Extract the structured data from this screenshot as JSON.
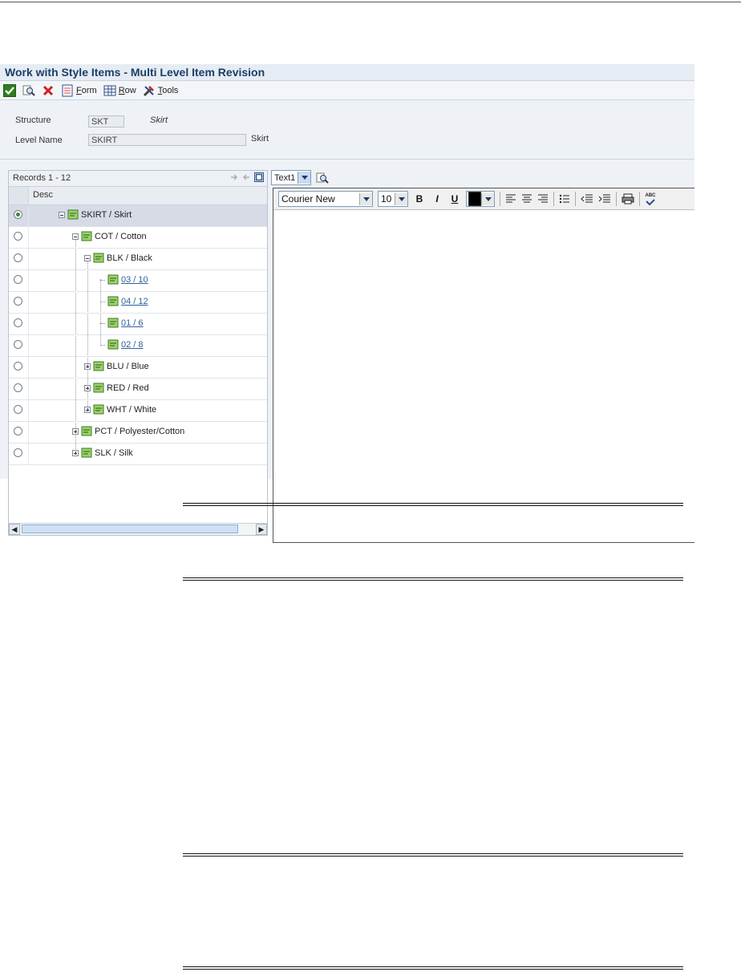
{
  "window": {
    "title": "Work with Style Items - Multi Level Item Revision"
  },
  "toolbar": {
    "form_label": "orm",
    "form_key": "F",
    "row_label": "ow",
    "row_key": "R",
    "tools_label": "ools",
    "tools_key": "T"
  },
  "header": {
    "structure_label": "Structure",
    "structure_value": "SKT",
    "structure_desc": "Skirt",
    "level_label": "Level Name",
    "level_value": "SKIRT",
    "level_desc": "Skirt"
  },
  "grid": {
    "caption": "Records 1 - 12",
    "column_desc": "Desc",
    "rows": [
      {
        "label": "SKIRT / Skirt",
        "selected": true
      },
      {
        "label": "COT / Cotton"
      },
      {
        "label": "BLK / Black"
      },
      {
        "label": "03 / 10"
      },
      {
        "label": "04 / 12"
      },
      {
        "label": "01 / 6"
      },
      {
        "label": "02 / 8"
      },
      {
        "label": "BLU / Blue"
      },
      {
        "label": "RED / Red"
      },
      {
        "label": "WHT / White"
      },
      {
        "label": "PCT / Polyester/Cotton"
      },
      {
        "label": "SLK / Silk"
      }
    ]
  },
  "media": {
    "selector_value": "Text1",
    "font_name": "Courier New",
    "font_size": "10",
    "bold_label": "B",
    "italic_label": "I",
    "underline_label": "U",
    "spell_label": "ABC"
  }
}
